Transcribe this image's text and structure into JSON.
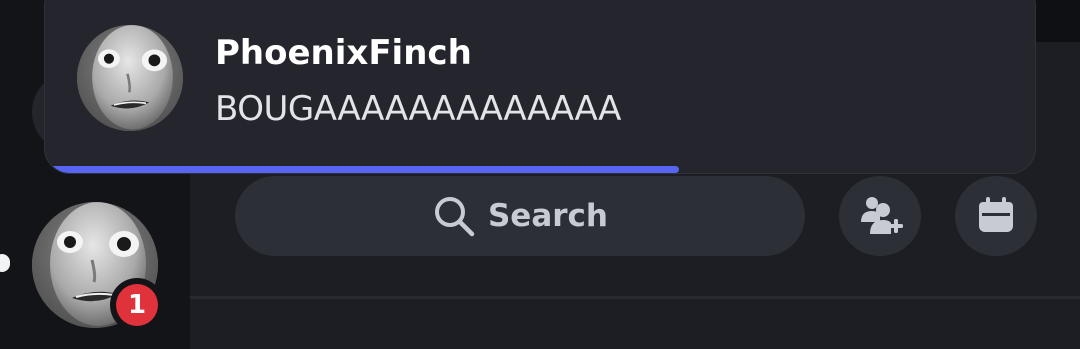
{
  "notification": {
    "author": "PhoenixFinch",
    "message": "BOUGAAAAAAAAAAAAA",
    "progress": 0.64,
    "accent_color": "#5865f2"
  },
  "rail": {
    "mention_count": "1",
    "badge_color": "#e0323b"
  },
  "search": {
    "label": "Search",
    "icon": "search-icon"
  },
  "actions": {
    "add_friend_icon": "add-friend-icon",
    "events_icon": "calendar-icon"
  }
}
